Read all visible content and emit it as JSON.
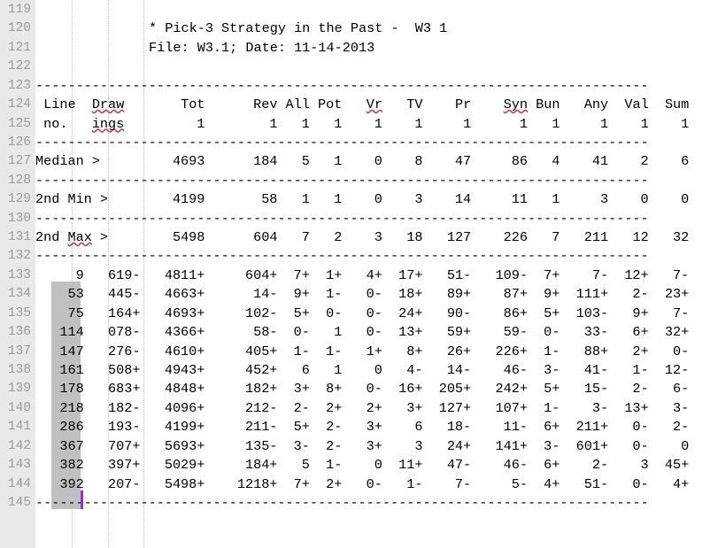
{
  "editor": {
    "first_line_number": 119,
    "last_line_number": 145,
    "gutter_color": "#e9e9e9",
    "line_number_color": "#9b9b9b",
    "selection_color": "#c0c0c0",
    "caret_color": "#9a30d0",
    "misspelling_underline_color": "#e03030"
  },
  "document": {
    "title_line": "* Pick-3 Strategy in the Past -  W3 1",
    "file_line": "File: W3.1; Date: 11-14-2013",
    "file_name": "W3.1",
    "date": "11-14-2013",
    "separator": "----------------------------------------------------------------------------",
    "columns": [
      {
        "name": "Line",
        "sub": "no.",
        "misspelled": false
      },
      {
        "name": "Draw",
        "sub": "ings",
        "misspelled": true
      },
      {
        "name": "Tot",
        "sub": "1",
        "misspelled": false
      },
      {
        "name": "Rev",
        "sub": "1",
        "misspelled": false
      },
      {
        "name": "All",
        "sub": "1",
        "misspelled": false
      },
      {
        "name": "Pot",
        "sub": "1",
        "misspelled": false
      },
      {
        "name": "Vr",
        "sub": "1",
        "misspelled": true
      },
      {
        "name": "TV",
        "sub": "1",
        "misspelled": false
      },
      {
        "name": "Pr",
        "sub": "1",
        "misspelled": false
      },
      {
        "name": "Syn",
        "sub": "1",
        "misspelled": true
      },
      {
        "name": "Bun",
        "sub": "1",
        "misspelled": false
      },
      {
        "name": "Any",
        "sub": "1",
        "misspelled": false
      },
      {
        "name": "Val",
        "sub": "1",
        "misspelled": false
      },
      {
        "name": "Sum",
        "sub": "1",
        "misspelled": false
      }
    ],
    "stats": [
      {
        "label": "Median > ",
        "values": [
          "4693",
          "184",
          "5",
          "1",
          "0",
          "8",
          "47",
          "86",
          "4",
          "41",
          "2",
          "6"
        ]
      },
      {
        "label": "2nd Min > ",
        "values": [
          "4199",
          "58",
          "1",
          "1",
          "0",
          "3",
          "14",
          "11",
          "1",
          "3",
          "0",
          "0"
        ]
      },
      {
        "label": "2nd Max > ",
        "values": [
          "5498",
          "604",
          "7",
          "2",
          "3",
          "18",
          "127",
          "226",
          "7",
          "211",
          "12",
          "32"
        ]
      }
    ],
    "rows": [
      {
        "line_no": "9",
        "drawings": "619-",
        "tot": "4811+",
        "rev": "604+",
        "all": "7+",
        "pot": "1+",
        "vr": "4+",
        "tv": "17+",
        "pr": "51-",
        "syn": "109-",
        "bun": "7+",
        "any": "7-",
        "val": "12+",
        "sum": "7-"
      },
      {
        "line_no": "53",
        "drawings": "445-",
        "tot": "4663+",
        "rev": "14-",
        "all": "9+",
        "pot": "1-",
        "vr": "0-",
        "tv": "18+",
        "pr": "89+",
        "syn": "87+",
        "bun": "9+",
        "any": "111+",
        "val": "2-",
        "sum": "23+"
      },
      {
        "line_no": "75",
        "drawings": "164+",
        "tot": "4693+",
        "rev": "102-",
        "all": "5+",
        "pot": "0-",
        "vr": "0-",
        "tv": "24+",
        "pr": "90-",
        "syn": "86+",
        "bun": "5+",
        "any": "103-",
        "val": "9+",
        "sum": "7-"
      },
      {
        "line_no": "114",
        "drawings": "078-",
        "tot": "4366+",
        "rev": "58-",
        "all": "0-",
        "pot": "1",
        "vr": "0-",
        "tv": "13+",
        "pr": "59+",
        "syn": "59-",
        "bun": "0-",
        "any": "33-",
        "val": "6+",
        "sum": "32+"
      },
      {
        "line_no": "147",
        "drawings": "276-",
        "tot": "4610+",
        "rev": "405+",
        "all": "1-",
        "pot": "1-",
        "vr": "1+",
        "tv": "8+",
        "pr": "26+",
        "syn": "226+",
        "bun": "1-",
        "any": "88+",
        "val": "2+",
        "sum": "0-"
      },
      {
        "line_no": "161",
        "drawings": "508+",
        "tot": "4943+",
        "rev": "452+",
        "all": "6",
        "pot": "1",
        "vr": "0",
        "tv": "4-",
        "pr": "14-",
        "syn": "46-",
        "bun": "3-",
        "any": "41-",
        "val": "1-",
        "sum": "12-"
      },
      {
        "line_no": "178",
        "drawings": "683+",
        "tot": "4848+",
        "rev": "182+",
        "all": "3+",
        "pot": "8+",
        "vr": "0-",
        "tv": "16+",
        "pr": "205+",
        "syn": "242+",
        "bun": "5+",
        "any": "15-",
        "val": "2-",
        "sum": "6-"
      },
      {
        "line_no": "218",
        "drawings": "182-",
        "tot": "4096+",
        "rev": "212-",
        "all": "2-",
        "pot": "2+",
        "vr": "2+",
        "tv": "3+",
        "pr": "127+",
        "syn": "107+",
        "bun": "1-",
        "any": "3-",
        "val": "13+",
        "sum": "3-"
      },
      {
        "line_no": "286",
        "drawings": "193-",
        "tot": "4199+",
        "rev": "211-",
        "all": "5+",
        "pot": "2-",
        "vr": "3+",
        "tv": "6",
        "pr": "18-",
        "syn": "11-",
        "bun": "6+",
        "any": "211+",
        "val": "0-",
        "sum": "2-"
      },
      {
        "line_no": "367",
        "drawings": "707+",
        "tot": "5693+",
        "rev": "135-",
        "all": "3-",
        "pot": "2-",
        "vr": "3+",
        "tv": "3",
        "pr": "24+",
        "syn": "141+",
        "bun": "3-",
        "any": "601+",
        "val": "0-",
        "sum": "0"
      },
      {
        "line_no": "382",
        "drawings": "397+",
        "tot": "5029+",
        "rev": "184+",
        "all": "5",
        "pot": "1-",
        "vr": "0",
        "tv": "11+",
        "pr": "47-",
        "syn": "46-",
        "bun": "6+",
        "any": "2-",
        "val": "3",
        "sum": "45+"
      },
      {
        "line_no": "392",
        "drawings": "207-",
        "tot": "5498+",
        "rev": "1218+",
        "all": "7+",
        "pot": "2+",
        "vr": "0-",
        "tv": "1-",
        "pr": "7-",
        "syn": "5-",
        "bun": "4+",
        "any": "51-",
        "val": "0-",
        "sum": "4+"
      }
    ]
  }
}
